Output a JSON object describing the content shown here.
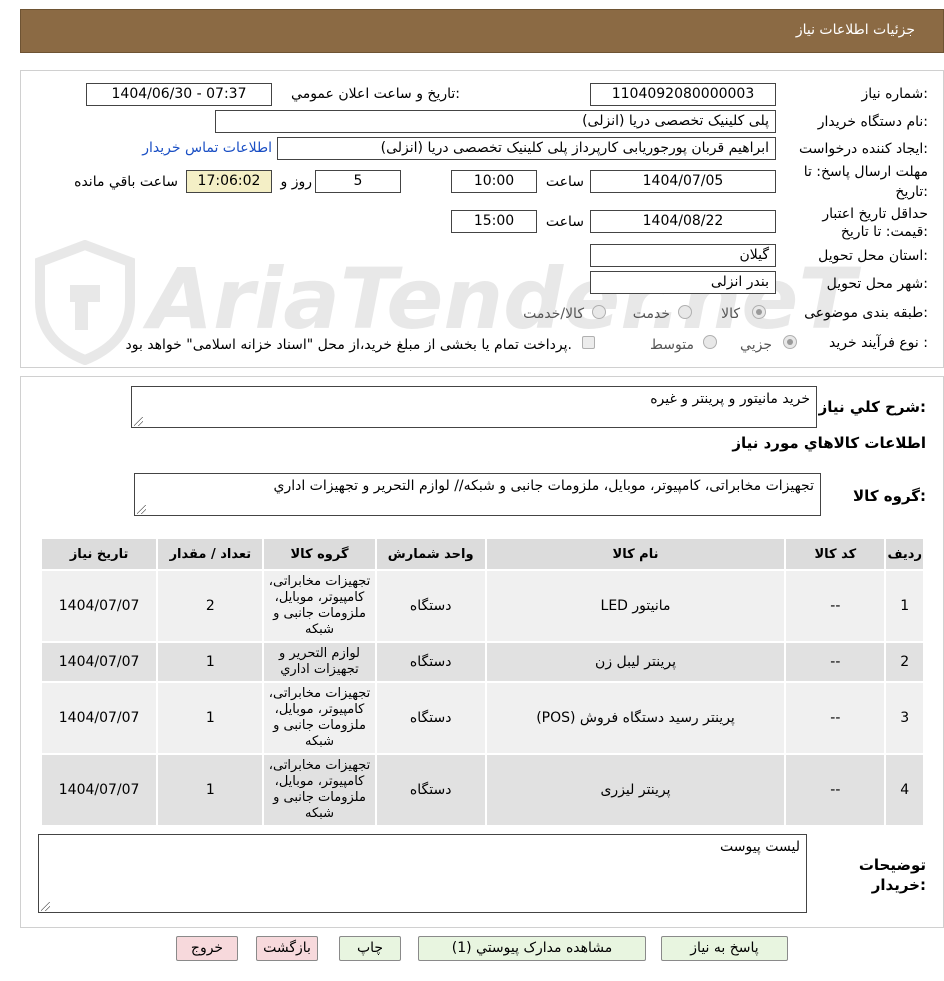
{
  "header": {
    "title": "جزئیات اطلاعات نیاز"
  },
  "watermark": {
    "text": "AriaTender.neT"
  },
  "form": {
    "need_number_label": "شماره نیاز:",
    "need_number": "1104092080000003",
    "announce_label": "تاریخ و ساعت اعلان عمومي:",
    "announce_value": "1404/06/30 - 07:37",
    "buyer_org_label": "نام دستگاه خريدار:",
    "buyer_org": "پلی کلینیک تخصصی دریا (انزلی)",
    "requester_label": "ايجاد کننده درخواست:",
    "requester": "ابراهیم قربان پورجوریابی کارپرداز پلی کلینیک تخصصی دریا (انزلی)",
    "contact_link": "اطلاعات تماس خريدار",
    "deadline_label_1": "مهلت ارسال پاسخ: تا",
    "deadline_label_2": "تاریخ:",
    "deadline_date": "1404/07/05",
    "time_label": "ساعت",
    "deadline_time": "10:00",
    "days_value": "5",
    "days_label": "روز و",
    "remaining_time": "17:06:02",
    "remaining_label": "ساعت باقي مانده",
    "validity_label_1": "حداقل تاریخ اعتبار",
    "validity_label_2": "قیمت: تا تاریخ:",
    "validity_date": "1404/08/22",
    "validity_time": "15:00",
    "province_label": "استان محل تحويل:",
    "province": "گيلان",
    "city_label": "شهر محل تحويل:",
    "city": "بندر انزلی",
    "category_label": "طبقه بندی موضوعی:",
    "category_options": [
      "کالا",
      "خدمت",
      "کالا/خدمت"
    ],
    "category_selected": "کالا",
    "process_label": "نوع فرآيند خريد :",
    "process_options": [
      "جزيي",
      "متوسط"
    ],
    "process_selected": "جزيي",
    "payment_note": "پرداخت تمام يا بخشی از مبلغ خريد،از محل \"اسناد خزانه اسلامی\" خواهد بود."
  },
  "details": {
    "summary_label": "شرح کلي نياز:",
    "summary": "خرید مانیتور و پرینتر و غیره",
    "goods_info_title": "اطلاعات کالاهاي مورد نياز",
    "goods_group_label": "گروه کالا:",
    "goods_group": "تجهیزات مخابراتی، کامپیوتر، موبایل، ملزومات جانبی و شبکه// لوازم التحرير و تجهيزات اداري",
    "table": {
      "headers": [
        "رديف",
        "کد کالا",
        "نام کالا",
        "واحد شمارش",
        "گروه کالا",
        "تعداد / مقدار",
        "تاریخ نیاز"
      ],
      "rows": [
        [
          "1",
          "--",
          "مانیتور LED",
          "دستگاه",
          "تجهیزات مخابراتی، کامپیوتر، موبایل، ملزومات جانبی و شبکه",
          "2",
          "1404/07/07"
        ],
        [
          "2",
          "--",
          "پرینتر لیبل زن",
          "دستگاه",
          "لوازم التحرير و تجهيزات اداري",
          "1",
          "1404/07/07"
        ],
        [
          "3",
          "--",
          "پرینتر رسید دستگاه فروش (POS)",
          "دستگاه",
          "تجهیزات مخابراتی، کامپیوتر، موبایل، ملزومات جانبی و شبکه",
          "1",
          "1404/07/07"
        ],
        [
          "4",
          "--",
          "پرینتر لیزری",
          "دستگاه",
          "تجهیزات مخابراتی، کامپیوتر، موبایل، ملزومات جانبی و شبکه",
          "1",
          "1404/07/07"
        ]
      ]
    },
    "buyer_notes_label_1": "توضيحات",
    "buyer_notes_label_2": "خريدار:",
    "buyer_notes": "لیست پیوست"
  },
  "buttons": {
    "reply": "پاسخ به نياز",
    "attachments": "مشاهده مدارک پيوستي (1)",
    "print": "چاپ",
    "back": "بازگشت",
    "exit": "خروج"
  },
  "colors": {
    "header_bg": "#8b6a44",
    "link": "#1a4fc4",
    "remaining_bg": "#f4efc6",
    "green_button": "#e8f5e0",
    "pink_button": "#f7d9dc"
  }
}
